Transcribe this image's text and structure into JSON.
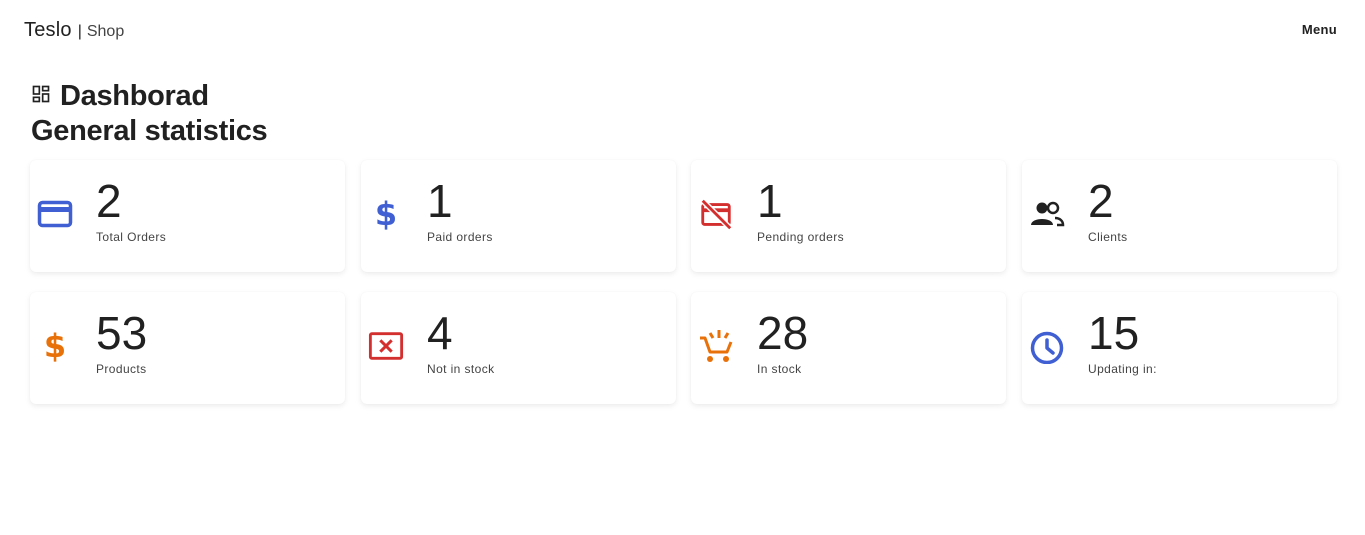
{
  "navbar": {
    "brand": "Teslo",
    "separator": "|",
    "brand_sub": "Shop",
    "menu_label": "Menu"
  },
  "header": {
    "title": "Dashborad",
    "title_icon": "dashboard-icon",
    "subtitle": "General statistics"
  },
  "colors": {
    "blue": "#3f5fd3",
    "red": "#d32f2f",
    "orange": "#e8710a",
    "dark": "#212121"
  },
  "cards": [
    {
      "value": "2",
      "label": "Total Orders",
      "icon": "credit-card-icon"
    },
    {
      "value": "1",
      "label": "Paid orders",
      "icon": "dollar-icon"
    },
    {
      "value": "1",
      "label": "Pending orders",
      "icon": "credit-card-off-icon"
    },
    {
      "value": "2",
      "label": "Clients",
      "icon": "group-icon"
    },
    {
      "value": "53",
      "label": "Products",
      "icon": "dollar-icon"
    },
    {
      "value": "4",
      "label": "Not in stock",
      "icon": "cancel-presentation-icon"
    },
    {
      "value": "28",
      "label": "In stock",
      "icon": "add-shopping-cart-icon"
    },
    {
      "value": "15",
      "label": "Updating in:",
      "icon": "clock-icon"
    }
  ]
}
